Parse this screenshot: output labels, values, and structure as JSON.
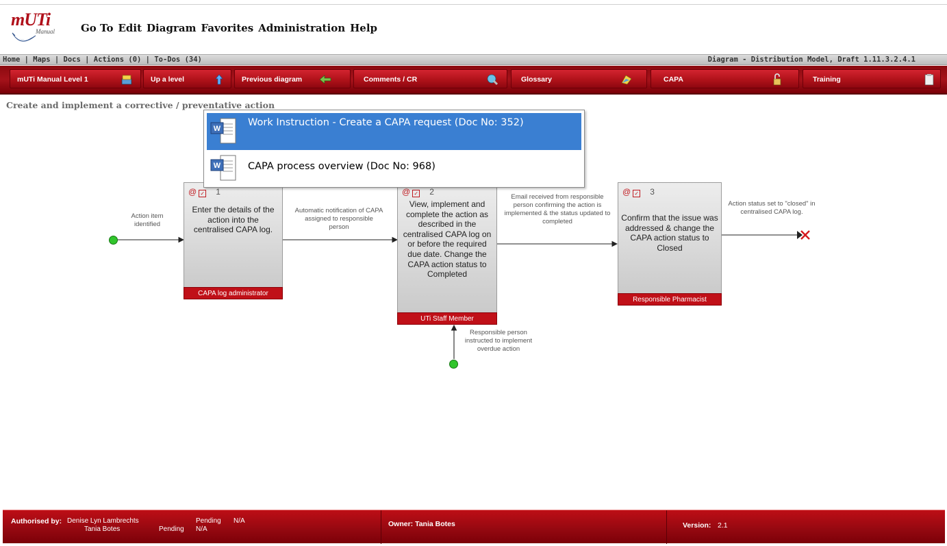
{
  "app": {
    "logo_text": "mUTi",
    "logo_subtext": "Manual",
    "menu": [
      "Go To",
      "Edit",
      "Diagram",
      "Favorites",
      "Administration",
      "Help"
    ]
  },
  "infobar": {
    "links": [
      "Home",
      "Maps",
      "Docs",
      "Actions (0)",
      "To-Dos (34)"
    ],
    "diagram_title": "Diagram - Distribution Model, Draft 1.11.3.2.4.1"
  },
  "toolbar": {
    "buttons": [
      {
        "label": "mUTi Manual Level 1",
        "icon": "book-stack-icon"
      },
      {
        "label": "Up a level",
        "icon": "up-arrow-icon"
      },
      {
        "label": "Previous diagram",
        "icon": "back-arrow-icon"
      },
      {
        "label": "Comments / CR",
        "icon": "comments-icon"
      },
      {
        "label": "Glossary",
        "icon": "glossary-icon"
      },
      {
        "label": "CAPA",
        "icon": "lock-icon"
      },
      {
        "label": "Training",
        "icon": "clipboard-icon"
      }
    ]
  },
  "breadcrumb": "Create and implement a corrective / preventative action",
  "popup": {
    "items": [
      {
        "label": "Work Instruction - Create a CAPA request (Doc No: 352)",
        "selected": true,
        "icon": "word-document-icon"
      },
      {
        "label": "CAPA process overview (Doc No: 968)",
        "selected": false,
        "icon": "word-document-icon"
      }
    ]
  },
  "diagram": {
    "start_labels": [
      "Action item identified",
      "Responsible person instructed to implement overdue action"
    ],
    "flows": [
      "Automatic notification of CAPA assigned to responsible person",
      "Email received from responsible person confirming the action is implemented & the status updated to completed",
      "Action status set to \"closed\" in centralised CAPA log."
    ],
    "activities": [
      {
        "number": "1",
        "text": "Enter the details of the action into the centralised CAPA log.",
        "role": "CAPA log administrator"
      },
      {
        "number": "2",
        "text": "View, implement and complete the action as described in the centralised CAPA log on or before the required due date.  Change the CAPA action status to Completed",
        "role": "UTi Staff Member"
      },
      {
        "number": "3",
        "text": "Confirm that the issue was addressed & change the CAPA action status to Closed",
        "role": "Responsible Pharmacist"
      }
    ],
    "head_glyph": "@"
  },
  "footer": {
    "authorised_label": "Authorised by:",
    "approvers": [
      {
        "name": "Denise Lyn Lambrechts",
        "status": "Pending",
        "date": "N/A"
      },
      {
        "name": "Tania Botes",
        "status": "Pending",
        "date": "N/A"
      }
    ],
    "owner": "Owner: Tania Botes",
    "version_label": "Version:",
    "version": "2.1"
  },
  "colors": {
    "brand_red": "#a5121a",
    "popup_selection": "#3a7fd2",
    "start_green": "#31c52c"
  }
}
